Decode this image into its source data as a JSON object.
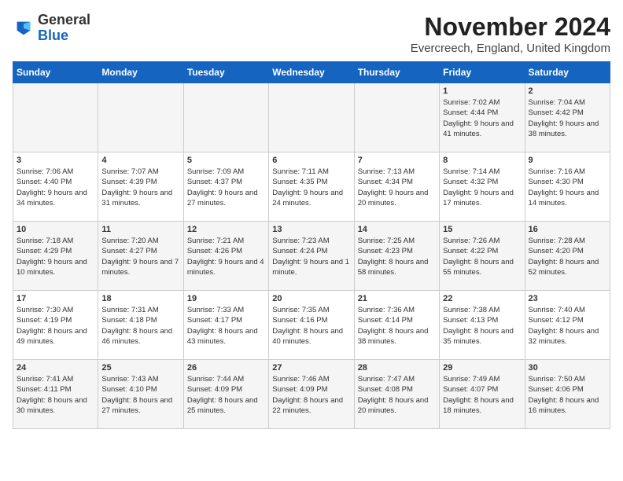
{
  "header": {
    "logo_general": "General",
    "logo_blue": "Blue",
    "month_title": "November 2024",
    "location": "Evercreech, England, United Kingdom"
  },
  "days_of_week": [
    "Sunday",
    "Monday",
    "Tuesday",
    "Wednesday",
    "Thursday",
    "Friday",
    "Saturday"
  ],
  "weeks": [
    [
      {
        "day": "",
        "info": ""
      },
      {
        "day": "",
        "info": ""
      },
      {
        "day": "",
        "info": ""
      },
      {
        "day": "",
        "info": ""
      },
      {
        "day": "",
        "info": ""
      },
      {
        "day": "1",
        "info": "Sunrise: 7:02 AM\nSunset: 4:44 PM\nDaylight: 9 hours and 41 minutes."
      },
      {
        "day": "2",
        "info": "Sunrise: 7:04 AM\nSunset: 4:42 PM\nDaylight: 9 hours and 38 minutes."
      }
    ],
    [
      {
        "day": "3",
        "info": "Sunrise: 7:06 AM\nSunset: 4:40 PM\nDaylight: 9 hours and 34 minutes."
      },
      {
        "day": "4",
        "info": "Sunrise: 7:07 AM\nSunset: 4:39 PM\nDaylight: 9 hours and 31 minutes."
      },
      {
        "day": "5",
        "info": "Sunrise: 7:09 AM\nSunset: 4:37 PM\nDaylight: 9 hours and 27 minutes."
      },
      {
        "day": "6",
        "info": "Sunrise: 7:11 AM\nSunset: 4:35 PM\nDaylight: 9 hours and 24 minutes."
      },
      {
        "day": "7",
        "info": "Sunrise: 7:13 AM\nSunset: 4:34 PM\nDaylight: 9 hours and 20 minutes."
      },
      {
        "day": "8",
        "info": "Sunrise: 7:14 AM\nSunset: 4:32 PM\nDaylight: 9 hours and 17 minutes."
      },
      {
        "day": "9",
        "info": "Sunrise: 7:16 AM\nSunset: 4:30 PM\nDaylight: 9 hours and 14 minutes."
      }
    ],
    [
      {
        "day": "10",
        "info": "Sunrise: 7:18 AM\nSunset: 4:29 PM\nDaylight: 9 hours and 10 minutes."
      },
      {
        "day": "11",
        "info": "Sunrise: 7:20 AM\nSunset: 4:27 PM\nDaylight: 9 hours and 7 minutes."
      },
      {
        "day": "12",
        "info": "Sunrise: 7:21 AM\nSunset: 4:26 PM\nDaylight: 9 hours and 4 minutes."
      },
      {
        "day": "13",
        "info": "Sunrise: 7:23 AM\nSunset: 4:24 PM\nDaylight: 9 hours and 1 minute."
      },
      {
        "day": "14",
        "info": "Sunrise: 7:25 AM\nSunset: 4:23 PM\nDaylight: 8 hours and 58 minutes."
      },
      {
        "day": "15",
        "info": "Sunrise: 7:26 AM\nSunset: 4:22 PM\nDaylight: 8 hours and 55 minutes."
      },
      {
        "day": "16",
        "info": "Sunrise: 7:28 AM\nSunset: 4:20 PM\nDaylight: 8 hours and 52 minutes."
      }
    ],
    [
      {
        "day": "17",
        "info": "Sunrise: 7:30 AM\nSunset: 4:19 PM\nDaylight: 8 hours and 49 minutes."
      },
      {
        "day": "18",
        "info": "Sunrise: 7:31 AM\nSunset: 4:18 PM\nDaylight: 8 hours and 46 minutes."
      },
      {
        "day": "19",
        "info": "Sunrise: 7:33 AM\nSunset: 4:17 PM\nDaylight: 8 hours and 43 minutes."
      },
      {
        "day": "20",
        "info": "Sunrise: 7:35 AM\nSunset: 4:16 PM\nDaylight: 8 hours and 40 minutes."
      },
      {
        "day": "21",
        "info": "Sunrise: 7:36 AM\nSunset: 4:14 PM\nDaylight: 8 hours and 38 minutes."
      },
      {
        "day": "22",
        "info": "Sunrise: 7:38 AM\nSunset: 4:13 PM\nDaylight: 8 hours and 35 minutes."
      },
      {
        "day": "23",
        "info": "Sunrise: 7:40 AM\nSunset: 4:12 PM\nDaylight: 8 hours and 32 minutes."
      }
    ],
    [
      {
        "day": "24",
        "info": "Sunrise: 7:41 AM\nSunset: 4:11 PM\nDaylight: 8 hours and 30 minutes."
      },
      {
        "day": "25",
        "info": "Sunrise: 7:43 AM\nSunset: 4:10 PM\nDaylight: 8 hours and 27 minutes."
      },
      {
        "day": "26",
        "info": "Sunrise: 7:44 AM\nSunset: 4:09 PM\nDaylight: 8 hours and 25 minutes."
      },
      {
        "day": "27",
        "info": "Sunrise: 7:46 AM\nSunset: 4:09 PM\nDaylight: 8 hours and 22 minutes."
      },
      {
        "day": "28",
        "info": "Sunrise: 7:47 AM\nSunset: 4:08 PM\nDaylight: 8 hours and 20 minutes."
      },
      {
        "day": "29",
        "info": "Sunrise: 7:49 AM\nSunset: 4:07 PM\nDaylight: 8 hours and 18 minutes."
      },
      {
        "day": "30",
        "info": "Sunrise: 7:50 AM\nSunset: 4:06 PM\nDaylight: 8 hours and 16 minutes."
      }
    ]
  ]
}
